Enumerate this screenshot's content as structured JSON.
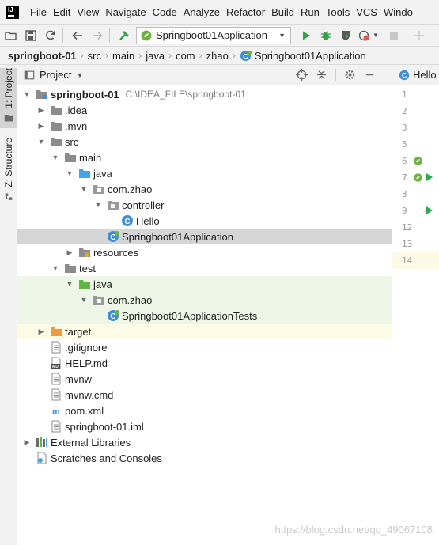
{
  "menubar": {
    "items": [
      {
        "label": "File"
      },
      {
        "label": "Edit"
      },
      {
        "label": "View"
      },
      {
        "label": "Navigate"
      },
      {
        "label": "Code"
      },
      {
        "label": "Analyze"
      },
      {
        "label": "Refactor"
      },
      {
        "label": "Build"
      },
      {
        "label": "Run"
      },
      {
        "label": "Tools"
      },
      {
        "label": "VCS"
      },
      {
        "label": "Windo"
      }
    ]
  },
  "toolbar": {
    "run_config_label": "Springboot01Application",
    "icons": [
      "folder-open-icon",
      "save-icon",
      "sync-icon",
      "back-icon",
      "forward-icon",
      "build-hammer-icon",
      "run-icon",
      "debug-icon",
      "coverage-icon",
      "profile-icon",
      "stop-icon"
    ]
  },
  "breadcrumb": {
    "items": [
      "springboot-01",
      "src",
      "main",
      "java",
      "com",
      "zhao",
      "Springboot01Application"
    ]
  },
  "side_tabs": {
    "project": "1: Project",
    "structure": "Z: Structure"
  },
  "project_panel": {
    "title": "Project",
    "tree": [
      {
        "label": "springboot-01",
        "path": "C:\\IDEA_FILE\\springboot-01",
        "icon": "module-folder-icon",
        "depth": 0,
        "arrow": "down",
        "bold": true
      },
      {
        "label": ".idea",
        "icon": "folder-icon",
        "depth": 1,
        "arrow": "right"
      },
      {
        "label": ".mvn",
        "icon": "folder-icon",
        "depth": 1,
        "arrow": "right"
      },
      {
        "label": "src",
        "icon": "folder-icon",
        "depth": 1,
        "arrow": "down"
      },
      {
        "label": "main",
        "icon": "folder-icon",
        "depth": 2,
        "arrow": "down"
      },
      {
        "label": "java",
        "icon": "source-folder-icon",
        "depth": 3,
        "arrow": "down"
      },
      {
        "label": "com.zhao",
        "icon": "package-icon",
        "depth": 4,
        "arrow": "down"
      },
      {
        "label": "controller",
        "icon": "package-icon",
        "depth": 5,
        "arrow": "down"
      },
      {
        "label": "Hello",
        "icon": "class-icon",
        "depth": 6,
        "arrow": "none"
      },
      {
        "label": "Springboot01Application",
        "icon": "spring-class-icon",
        "depth": 5,
        "arrow": "none",
        "selected": true
      },
      {
        "label": "resources",
        "icon": "resources-folder-icon",
        "depth": 3,
        "arrow": "right"
      },
      {
        "label": "test",
        "icon": "folder-icon",
        "depth": 2,
        "arrow": "down"
      },
      {
        "label": "java",
        "icon": "test-folder-icon",
        "depth": 3,
        "arrow": "down",
        "test": true
      },
      {
        "label": "com.zhao",
        "icon": "package-icon",
        "depth": 4,
        "arrow": "down",
        "test": true
      },
      {
        "label": "Springboot01ApplicationTests",
        "icon": "spring-class-icon",
        "depth": 5,
        "arrow": "none",
        "test": true
      },
      {
        "label": "target",
        "icon": "excluded-folder-icon",
        "depth": 1,
        "arrow": "right",
        "excluded": true
      },
      {
        "label": ".gitignore",
        "icon": "text-file-icon",
        "depth": 1,
        "arrow": "none"
      },
      {
        "label": "HELP.md",
        "icon": "markdown-file-icon",
        "depth": 1,
        "arrow": "none"
      },
      {
        "label": "mvnw",
        "icon": "text-file-icon",
        "depth": 1,
        "arrow": "none"
      },
      {
        "label": "mvnw.cmd",
        "icon": "text-file-icon",
        "depth": 1,
        "arrow": "none"
      },
      {
        "label": "pom.xml",
        "icon": "maven-file-icon",
        "depth": 1,
        "arrow": "none"
      },
      {
        "label": "springboot-01.iml",
        "icon": "text-file-icon",
        "depth": 1,
        "arrow": "none"
      },
      {
        "label": "External Libraries",
        "icon": "libraries-icon",
        "depth": 0,
        "arrow": "right"
      },
      {
        "label": "Scratches and Consoles",
        "icon": "scratches-icon",
        "depth": 0,
        "arrow": "none"
      }
    ]
  },
  "editor": {
    "tab_label": "Hello",
    "lines": [
      "1",
      "2",
      "3",
      "5",
      "6",
      "7",
      "8",
      "9",
      "12",
      "13",
      "14"
    ]
  },
  "watermark": "https://blog.csdn.net/qq_49067108"
}
